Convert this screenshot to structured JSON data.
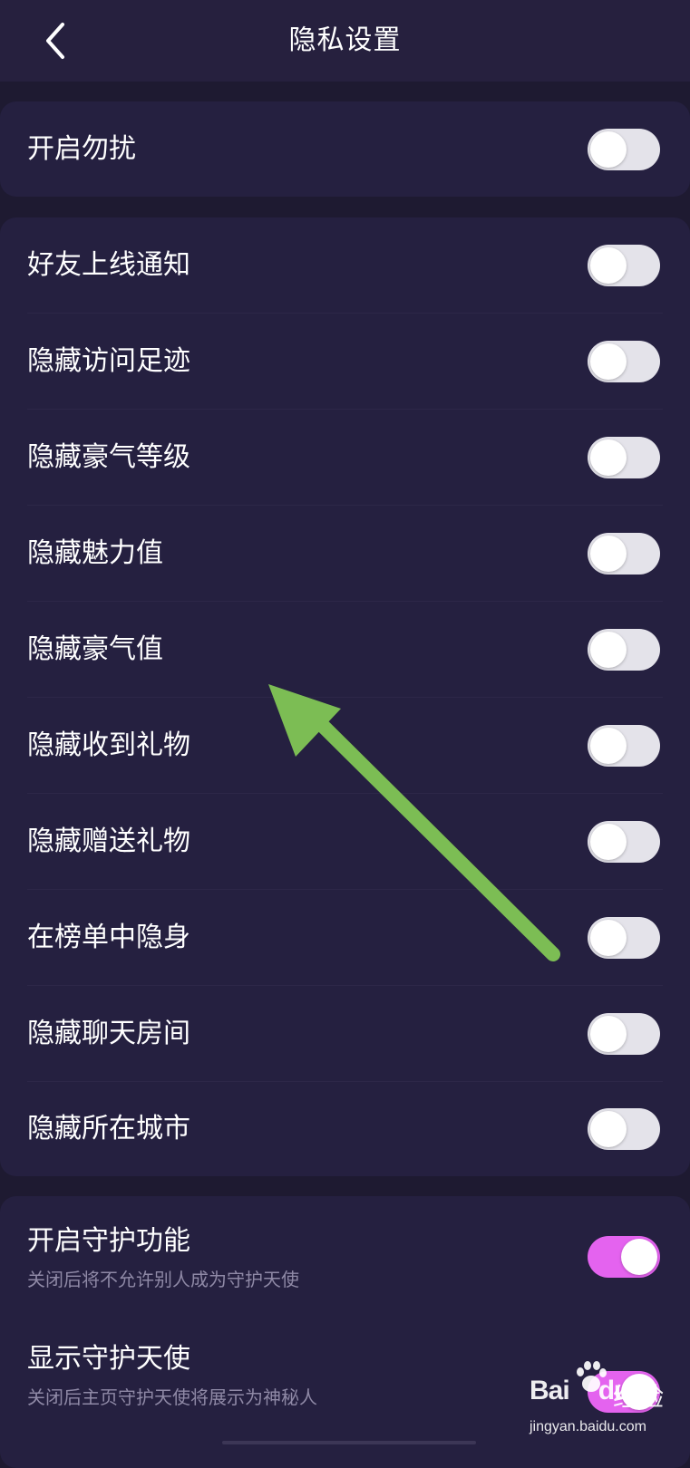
{
  "nav": {
    "title": "隐私设置",
    "back_icon": "chevron-left-icon"
  },
  "colors": {
    "background": "#1e1a31",
    "card": "#252040",
    "toggle_off": "#e4e3ea",
    "toggle_on": "#e463ef",
    "annotation_arrow": "#7cbd54"
  },
  "groups": [
    {
      "items": [
        {
          "label": "开启勿扰",
          "on": false
        }
      ]
    },
    {
      "items": [
        {
          "label": "好友上线通知",
          "on": false
        },
        {
          "label": "隐藏访问足迹",
          "on": false
        },
        {
          "label": "隐藏豪气等级",
          "on": false
        },
        {
          "label": "隐藏魅力值",
          "on": false
        },
        {
          "label": "隐藏豪气值",
          "on": false
        },
        {
          "label": "隐藏收到礼物",
          "on": false
        },
        {
          "label": "隐藏赠送礼物",
          "on": false
        },
        {
          "label": "在榜单中隐身",
          "on": false
        },
        {
          "label": "隐藏聊天房间",
          "on": false
        },
        {
          "label": "隐藏所在城市",
          "on": false
        }
      ]
    },
    {
      "items": [
        {
          "label": "开启守护功能",
          "sublabel": "关闭后将不允许别人成为守护天使",
          "on": true
        },
        {
          "label": "显示守护天使",
          "sublabel": "关闭后主页守护天使将展示为神秘人",
          "on": true
        }
      ]
    }
  ],
  "watermark": {
    "logo": "Bai",
    "logo_suffix": "du",
    "name": "经验",
    "url": "jingyan.baidu.com"
  }
}
